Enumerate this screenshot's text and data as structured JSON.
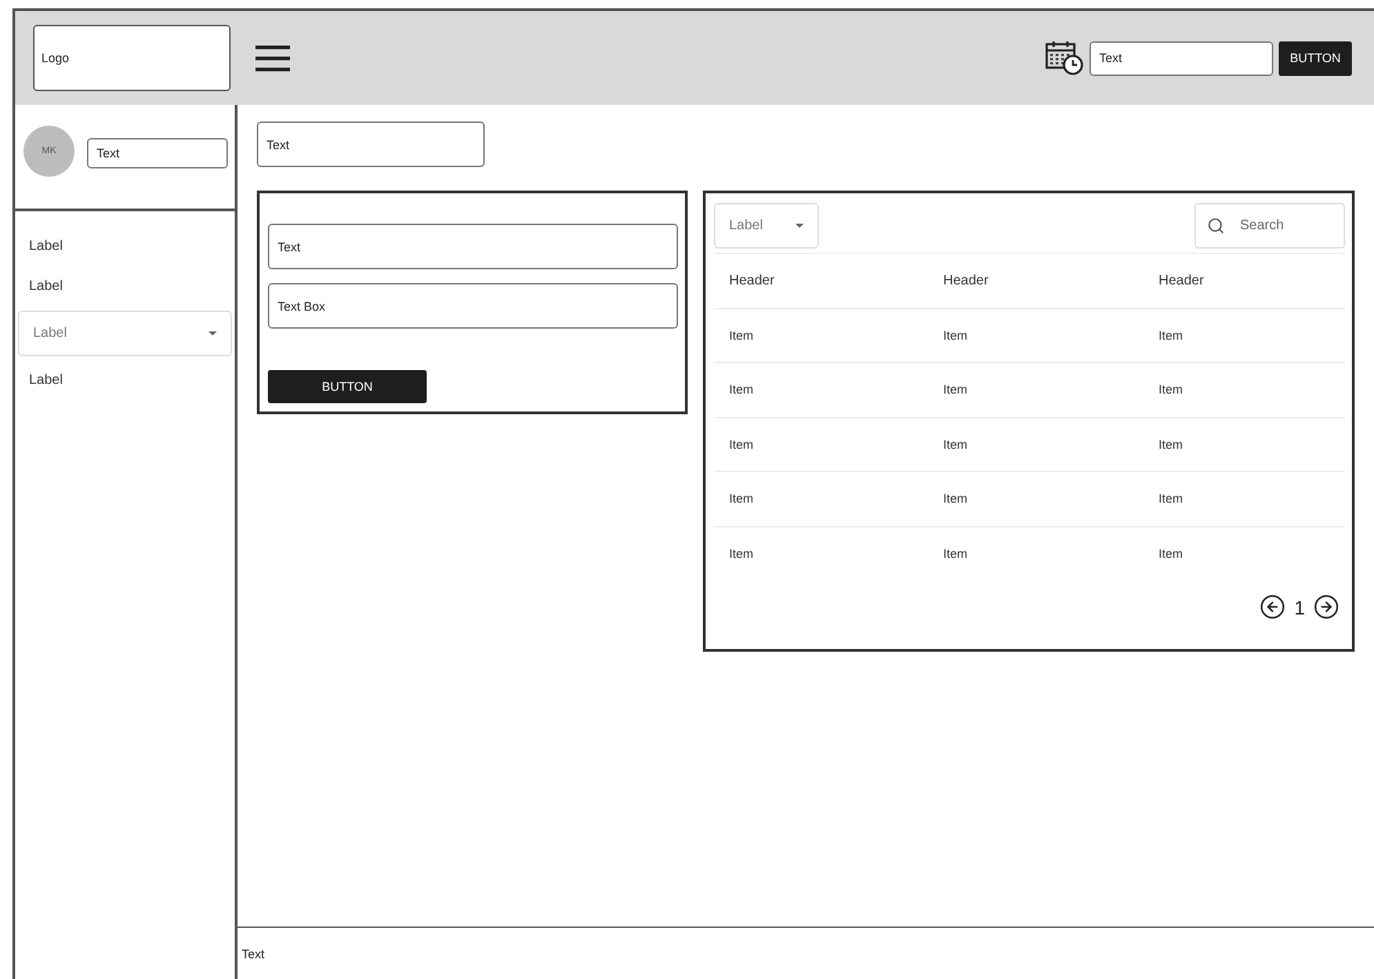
{
  "header": {
    "logo": "Logo",
    "search_field": {
      "value": "Text"
    },
    "button": "BUTTON"
  },
  "sidebar": {
    "avatar_initials": "MK",
    "name_field": {
      "value": "Text"
    },
    "items": [
      {
        "kind": "link",
        "label": "Label"
      },
      {
        "kind": "link",
        "label": "Label"
      },
      {
        "kind": "dropdown",
        "label": "Label"
      },
      {
        "kind": "link",
        "label": "Label"
      }
    ]
  },
  "top_field": {
    "value": "Text"
  },
  "form": {
    "fields": [
      {
        "value": "Text"
      },
      {
        "value": "Text Box"
      }
    ],
    "button": "BUTTON"
  },
  "table": {
    "filter": {
      "label": "Label"
    },
    "search": {
      "placeholder": "Search"
    },
    "columns": [
      "Header",
      "Header",
      "Header"
    ],
    "rows": [
      [
        "Item",
        "Item",
        "Item"
      ],
      [
        "Item",
        "Item",
        "Item"
      ],
      [
        "Item",
        "Item",
        "Item"
      ],
      [
        "Item",
        "Item",
        "Item"
      ],
      [
        "Item",
        "Item",
        "Item"
      ]
    ],
    "page": "1"
  },
  "footer": {
    "text": "Text"
  }
}
